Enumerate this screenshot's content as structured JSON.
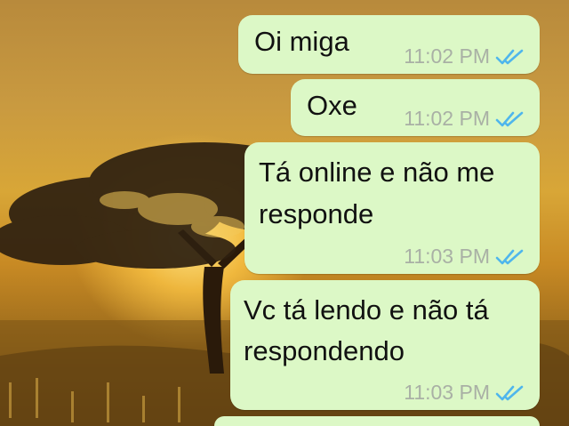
{
  "chat": {
    "messages": [
      {
        "text": "Oi miga",
        "time": "11:02 PM",
        "status_icon": "double-check-read-icon"
      },
      {
        "text": "Oxe",
        "time": "11:02 PM",
        "status_icon": "double-check-read-icon"
      },
      {
        "lines": [
          "Tá online e não me",
          "responde"
        ],
        "time": "11:03 PM",
        "status_icon": "double-check-read-icon"
      },
      {
        "lines": [
          "Vc tá lendo e não tá",
          "respondendo"
        ],
        "time": "11:03 PM",
        "status_icon": "double-check-read-icon"
      }
    ]
  },
  "colors": {
    "outgoing_bubble": "#dcf8c6",
    "read_ticks": "#4fb6ec",
    "timestamp": "#a9b0a5"
  },
  "wallpaper": "acacia-tree-sunset-image"
}
